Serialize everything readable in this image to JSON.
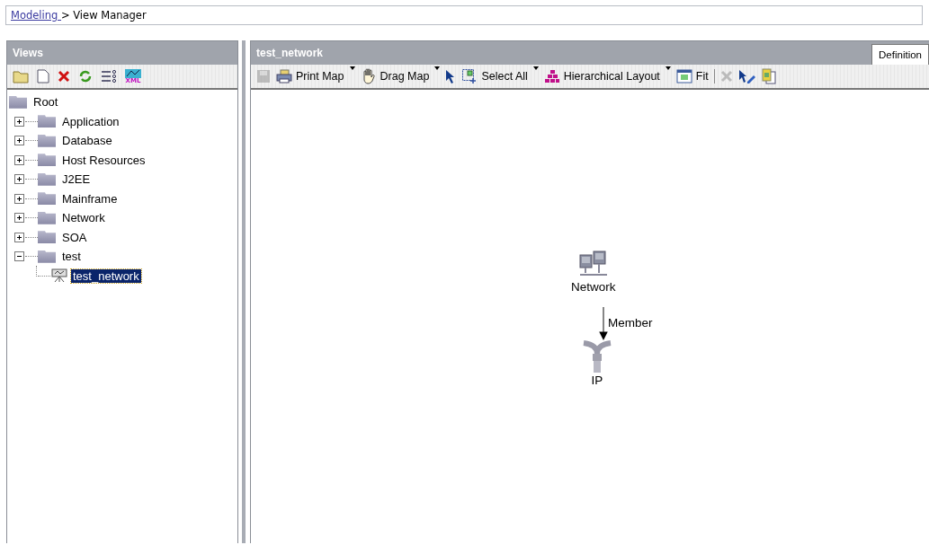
{
  "breadcrumb": {
    "link": "Modeling ",
    "current": "> View Manager"
  },
  "views_panel": {
    "title": "Views",
    "toolbar": [
      {
        "kind": "folder"
      },
      {
        "kind": "page"
      },
      {
        "kind": "delete"
      },
      {
        "kind": "refresh"
      },
      {
        "kind": "list"
      },
      {
        "kind": "xml",
        "label": "XML"
      }
    ],
    "tree": {
      "label": "Root",
      "kind": "folder",
      "children": [
        {
          "label": "Application",
          "kind": "folder",
          "expanded": false,
          "selected": false
        },
        {
          "label": "Database",
          "kind": "folder",
          "expanded": false,
          "selected": false
        },
        {
          "label": "Host Resources",
          "kind": "folder",
          "expanded": false,
          "selected": false
        },
        {
          "label": "J2EE",
          "kind": "folder",
          "expanded": false,
          "selected": false
        },
        {
          "label": "Mainframe",
          "kind": "folder",
          "expanded": false,
          "selected": false
        },
        {
          "label": "Network",
          "kind": "folder",
          "expanded": false,
          "selected": false
        },
        {
          "label": "SOA",
          "kind": "folder",
          "expanded": false,
          "selected": false
        },
        {
          "label": "test",
          "kind": "folder",
          "expanded": true,
          "selected": false,
          "children": [
            {
              "label": "test_network",
              "kind": "view",
              "selected": true
            }
          ]
        }
      ]
    }
  },
  "map_panel": {
    "title": "test_network",
    "tabs": [
      {
        "label": "Definition",
        "selected": true
      }
    ],
    "toolbar": [
      {
        "kind": "save",
        "disabled": true
      },
      {
        "kind": "print",
        "label": "Print Map",
        "disabled": false,
        "dropdown": true
      },
      {
        "kind": "hand",
        "label": "Drag Map",
        "disabled": false,
        "dropdown": true
      },
      {
        "kind": "pointer",
        "disabled": false
      },
      {
        "kind": "select",
        "label": "Select All",
        "disabled": false,
        "dropdown": true
      },
      {
        "kind": "hierarchy",
        "label": "Hierarchical Layout",
        "disabled": false,
        "dropdown": true
      },
      {
        "kind": "fit",
        "label": "Fit",
        "disabled": false
      },
      {
        "kind": "separator"
      },
      {
        "kind": "delete",
        "disabled": true
      },
      {
        "kind": "edit-pointer",
        "disabled": false
      },
      {
        "kind": "clipboard",
        "disabled": false
      }
    ],
    "nodes": [
      {
        "label": "Network",
        "kind": "network"
      },
      {
        "label": "IP",
        "kind": "ip"
      }
    ],
    "edges": [
      {
        "label": "Member"
      }
    ]
  }
}
